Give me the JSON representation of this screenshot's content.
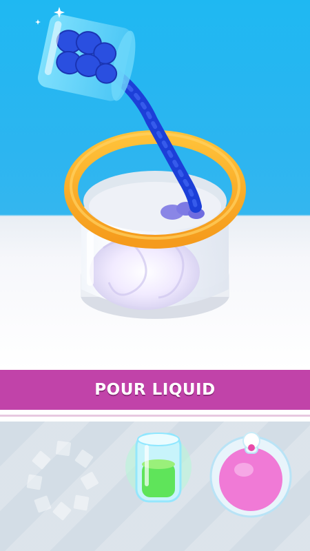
{
  "action_banner": {
    "label": "POUR LIQUID"
  },
  "tools": [
    {
      "name": "mixer",
      "state": "locked"
    },
    {
      "name": "green-cup",
      "liquid_color": "#5fe45a"
    },
    {
      "name": "pink-flask",
      "liquid_color": "#f07ad6"
    }
  ],
  "colors": {
    "sky": "#1fb8f2",
    "banner": "#c143a9",
    "rim": "#fbb02a",
    "pour_liquid": "#1c3fd8",
    "tray": "#d3dde6"
  }
}
